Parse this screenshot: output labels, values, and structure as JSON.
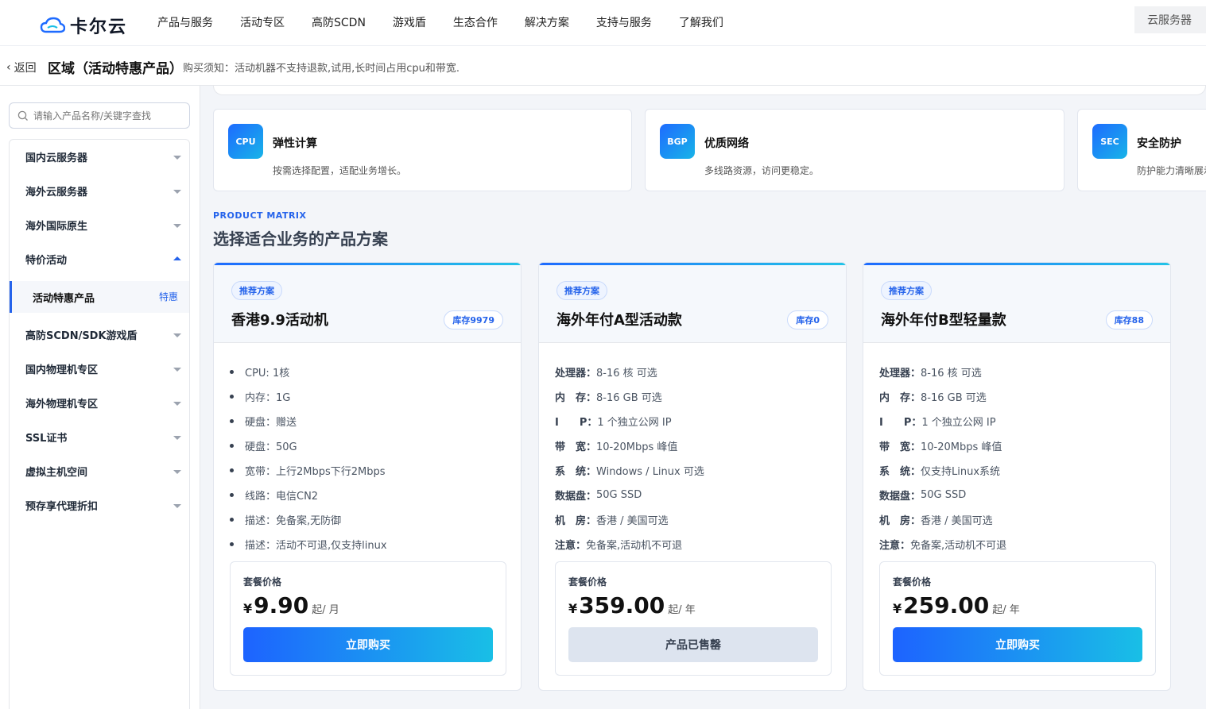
{
  "brand": {
    "name": "卡尔云"
  },
  "nav": {
    "items": [
      "产品与服务",
      "活动专区",
      "高防SCDN",
      "游戏盾",
      "生态合作",
      "解决方案",
      "支持与服务",
      "了解我们"
    ],
    "right_button": "云服务器"
  },
  "subbar": {
    "back_label": "返回",
    "title": "区域（活动特惠产品）",
    "notice": "购买须知：活动机器不支持退款,试用,长时间占用cpu和带宽."
  },
  "sidebar": {
    "search_placeholder": "请输入产品名称/关键字查找",
    "items": [
      {
        "label": "国内云服务器"
      },
      {
        "label": "海外云服务器"
      },
      {
        "label": "海外国际原生"
      },
      {
        "label": "特价活动"
      },
      {
        "label": "高防SCDN/SDK游戏盾"
      },
      {
        "label": "国内物理机专区"
      },
      {
        "label": "海外物理机专区"
      },
      {
        "label": "SSL证书"
      },
      {
        "label": "虚拟主机空间"
      },
      {
        "label": "预存享代理折扣"
      }
    ],
    "active_sub": {
      "label": "活动特惠产品",
      "tag": "特惠"
    }
  },
  "features": [
    {
      "icon": "CPU",
      "title": "弹性计算",
      "desc": "按需选择配置，适配业务增长。"
    },
    {
      "icon": "BGP",
      "title": "优质网络",
      "desc": "多线路资源，访问更稳定。"
    },
    {
      "icon": "SEC",
      "title": "安全防护",
      "desc": "防护能力清晰展示"
    }
  ],
  "matrix": {
    "eyebrow": "PRODUCT MATRIX",
    "title": "选择适合业务的产品方案"
  },
  "cards": [
    {
      "badge": "推荐方案",
      "name": "香港9.9活动机",
      "stock": "库存9979",
      "specs": [
        "CPU: 1核",
        "内存：1G",
        "硬盘：赠送",
        "硬盘：50G",
        "宽带：上行2Mbps下行2Mbps",
        "线路：电信CN2",
        "描述：免备案,无防御",
        "描述：活动不可退,仅支持linux"
      ],
      "price_label": "套餐价格",
      "currency": "¥",
      "price": "9.90",
      "unit": "起/ 月",
      "button": "立即购买"
    },
    {
      "badge": "推荐方案",
      "name": "海外年付A型活动款",
      "stock": "库存0",
      "specs": [
        {
          "k": "处理器：",
          "v": "8-16 核 可选"
        },
        {
          "k": "内　存：",
          "v": "8-16 GB 可选"
        },
        {
          "k": "I　　P：",
          "v": "1 个独立公网 IP"
        },
        {
          "k": "带　宽：",
          "v": "10-20Mbps 峰值"
        },
        {
          "k": "系　统：",
          "v": "Windows / Linux 可选"
        },
        {
          "k": "数据盘：",
          "v": "50G SSD"
        },
        {
          "k": "机　房：",
          "v": "香港 / 美国可选"
        },
        {
          "k": "注意：",
          "v": "免备案,活动机不可退"
        }
      ],
      "price_label": "套餐价格",
      "currency": "¥",
      "price": "359.00",
      "unit": "起/ 年",
      "button": "产品已售罄"
    },
    {
      "badge": "推荐方案",
      "name": "海外年付B型轻量款",
      "stock": "库存88",
      "specs": [
        {
          "k": "处理器：",
          "v": "8-16 核 可选"
        },
        {
          "k": "内　存：",
          "v": "8-16 GB 可选"
        },
        {
          "k": "I　　P：",
          "v": "1 个独立公网 IP"
        },
        {
          "k": "带　宽：",
          "v": "10-20Mbps 峰值"
        },
        {
          "k": "系　统：",
          "v": "仅支持Linux系统"
        },
        {
          "k": "数据盘：",
          "v": "50G SSD"
        },
        {
          "k": "机　房：",
          "v": "香港 / 美国可选"
        },
        {
          "k": "注意：",
          "v": "免备案,活动机不可退"
        }
      ],
      "price_label": "套餐价格",
      "currency": "¥",
      "price": "259.00",
      "unit": "起/ 年",
      "button": "立即购买"
    }
  ]
}
